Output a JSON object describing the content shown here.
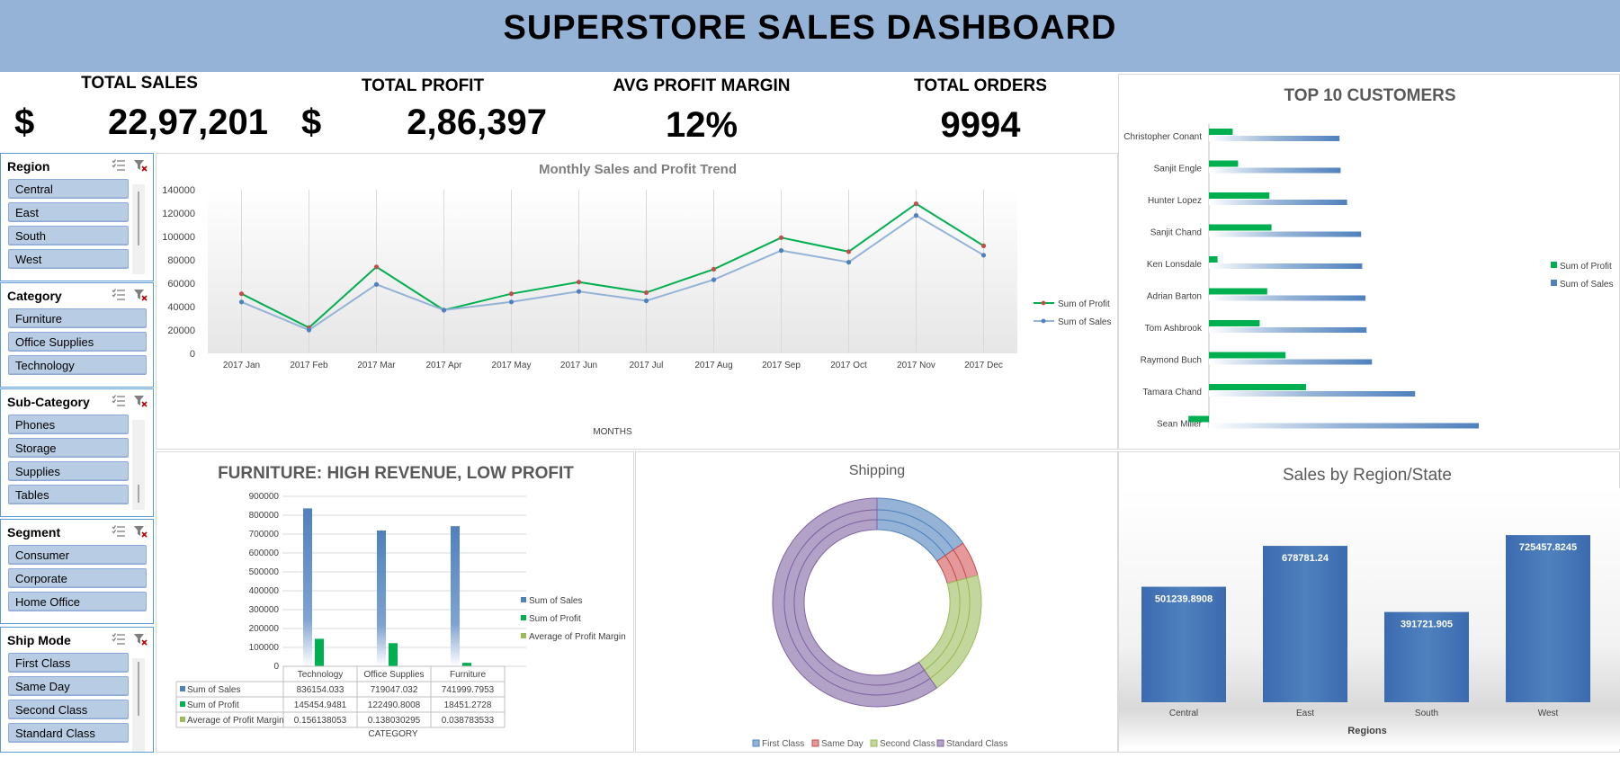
{
  "header": {
    "title": "SUPERSTORE SALES DASHBOARD"
  },
  "kpis": {
    "total_sales": {
      "label": "TOTAL SALES",
      "currency": "$",
      "value": "22,97,201"
    },
    "total_profit": {
      "label": "TOTAL PROFIT",
      "currency": "$",
      "value": "2,86,397"
    },
    "avg_margin": {
      "label": "AVG PROFIT MARGIN",
      "value": "12%"
    },
    "total_orders": {
      "label": "TOTAL ORDERS",
      "value": "9994"
    }
  },
  "slicers": {
    "region": {
      "title": "Region",
      "items": [
        "Central",
        "East",
        "South",
        "West"
      ]
    },
    "category": {
      "title": "Category",
      "items": [
        "Furniture",
        "Office Supplies",
        "Technology"
      ]
    },
    "subcategory": {
      "title": "Sub-Category",
      "items": [
        "Phones",
        "Storage",
        "Supplies",
        "Tables"
      ]
    },
    "segment": {
      "title": "Segment",
      "items": [
        "Consumer",
        "Corporate",
        "Home Office"
      ]
    },
    "shipmode": {
      "title": "Ship Mode",
      "items": [
        "First Class",
        "Same Day",
        "Second Class",
        "Standard Class"
      ]
    }
  },
  "colors": {
    "header_bg": "#95b3d7",
    "sales_blue": "#4f81bd",
    "profit_green": "#00b050",
    "slicer_item": "#b8cce4",
    "margin_lightgreen": "#9bbb59"
  },
  "chart_data": [
    {
      "type": "line",
      "title": "Monthly Sales and Profit Trend",
      "xlabel": "MONTHS",
      "ylabel": "",
      "ylim": [
        0,
        140000
      ],
      "yticks": [
        "0",
        "20000",
        "40000",
        "60000",
        "80000",
        "100000",
        "120000",
        "140000"
      ],
      "categories": [
        "2017 Jan",
        "2017 Feb",
        "2017 Mar",
        "2017 Apr",
        "2017 May",
        "2017 Jun",
        "2017 Jul",
        "2017 Aug",
        "2017 Sep",
        "2017 Oct",
        "2017 Nov",
        "2017 Dec"
      ],
      "series": [
        {
          "name": "Sum of Profit",
          "color": "#00b050",
          "values": [
            51000,
            22000,
            74000,
            37000,
            51000,
            61000,
            52000,
            72000,
            99000,
            87000,
            128000,
            92000
          ]
        },
        {
          "name": "Sum of Sales",
          "color": "#4f81bd",
          "values": [
            44000,
            20000,
            59000,
            37000,
            44000,
            53000,
            45000,
            63000,
            88000,
            78000,
            118000,
            84000
          ]
        }
      ],
      "legend": "right"
    },
    {
      "type": "bar",
      "orientation": "horizontal",
      "title": "TOP 10 CUSTOMERS",
      "categories": [
        "Christopher Conant",
        "Sanjit Engle",
        "Hunter Lopez",
        "Sanjit Chand",
        "Ken Lonsdale",
        "Adrian Barton",
        "Tom Ashbrook",
        "Raymond Buch",
        "Tamara Chand",
        "Sean Miller"
      ],
      "series": [
        {
          "name": "Sum of Profit",
          "color": "#00b050",
          "values": [
            2200,
            2700,
            5600,
            5800,
            800,
            5400,
            4700,
            7100,
            9000,
            -1900
          ]
        },
        {
          "name": "Sum of Sales",
          "color": "#4f81bd",
          "values": [
            12100,
            12200,
            12800,
            14100,
            14200,
            14500,
            14600,
            15100,
            19100,
            25000
          ]
        }
      ],
      "legend": "right"
    },
    {
      "type": "bar",
      "title": "FURNITURE: HIGH REVENUE, LOW PROFIT",
      "xlabel": "CATEGORY",
      "ylim": [
        0,
        900000
      ],
      "yticks": [
        "0",
        "100000",
        "200000",
        "300000",
        "400000",
        "500000",
        "600000",
        "700000",
        "800000",
        "900000"
      ],
      "categories": [
        "Technology",
        "Office Supplies",
        "Furniture"
      ],
      "series": [
        {
          "name": "Sum of Sales",
          "color": "#4f81bd",
          "values": [
            836154.033,
            719047.032,
            741999.7953
          ],
          "labels": [
            "836154.033",
            "719047.032",
            "741999.7953"
          ]
        },
        {
          "name": "Sum of Profit",
          "color": "#00b050",
          "values": [
            145454.9481,
            122490.8008,
            18451.2728
          ],
          "labels": [
            "145454.9481",
            "122490.8008",
            "18451.2728"
          ]
        },
        {
          "name": "Average of Profit Margin",
          "color": "#9bbb59",
          "values": [
            0.156138053,
            0.138030295,
            0.038783533
          ],
          "labels": [
            "0.156138053",
            "0.138030295",
            "0.038783533"
          ]
        }
      ],
      "legend": "right"
    },
    {
      "type": "pie",
      "subtype": "doughnut",
      "title": "Shipping",
      "categories": [
        "First Class",
        "Same Day",
        "Second Class",
        "Standard Class"
      ],
      "colors": [
        "#95b3d7",
        "#e6999a",
        "#c3d69b",
        "#b3a2c7"
      ],
      "values": [
        15.4,
        5.4,
        19.5,
        59.7
      ],
      "legend": "bottom"
    },
    {
      "type": "bar",
      "title": "Sales by Region/State",
      "xlabel": "Regions",
      "categories": [
        "Central",
        "East",
        "South",
        "West"
      ],
      "values": [
        501239.8908,
        678781.24,
        391721.905,
        725457.8245
      ],
      "labels": [
        "501239.8908",
        "678781.24",
        "391721.905",
        "725457.8245"
      ],
      "ylim": [
        0,
        800000
      ]
    }
  ]
}
